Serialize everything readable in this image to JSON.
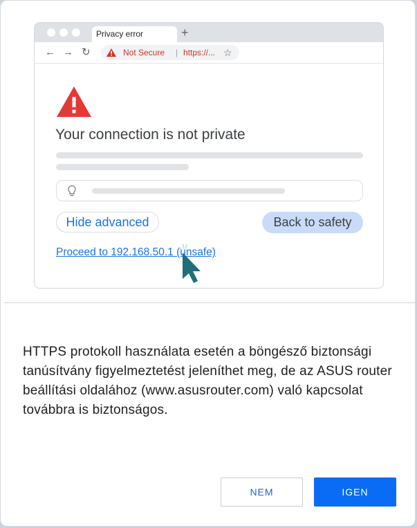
{
  "illustration": {
    "tab_title": "Privacy error",
    "new_tab_glyph": "+",
    "nav": {
      "back_icon": "←",
      "forward_icon": "→",
      "reload_icon": "↻"
    },
    "omnibox": {
      "security_label": "Not Secure",
      "separator": "|",
      "url": "https://...",
      "star_icon": "☆"
    },
    "headline": "Your connection is not private",
    "hide_advanced": "Hide advanced",
    "back_to_safety": "Back to safety",
    "proceed_link": "Proceed to 192.168.50.1 (unsafe)"
  },
  "message": "HTTPS protokoll használata esetén a böngésző biztonsági tanúsítvány figyelmeztetést jeleníthet meg, de az ASUS router beállítási oldalához (www.asusrouter.com) való kapcsolat továbbra is biztonságos.",
  "buttons": {
    "no": "NEM",
    "yes": "IGEN"
  },
  "colors": {
    "primary": "#0a6cf5",
    "warning_red": "#d93025",
    "link_blue": "#1a73e8",
    "cursor_teal": "#1f6f7a"
  }
}
